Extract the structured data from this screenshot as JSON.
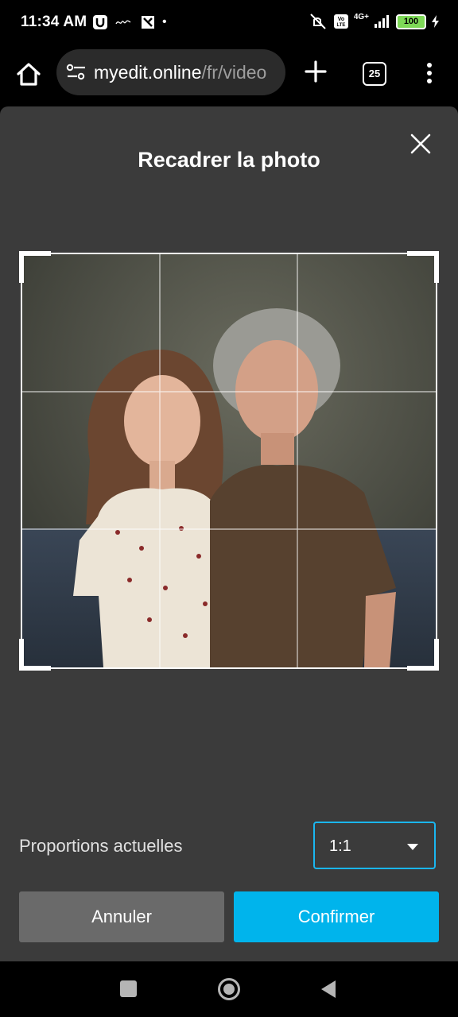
{
  "status": {
    "time": "11:34 AM",
    "battery": "100",
    "network": "4G+"
  },
  "browser": {
    "url_host": "myedit.online",
    "url_path": "/fr/video",
    "tab_count": "25"
  },
  "dialog": {
    "title": "Recadrer la photo",
    "proportions_label": "Proportions actuelles",
    "ratio_selected": "1:1",
    "cancel_label": "Annuler",
    "confirm_label": "Confirmer"
  },
  "colors": {
    "accent": "#00b4ec",
    "dialog_bg": "#3b3b3b",
    "cancel_bg": "#6a6a6a"
  }
}
